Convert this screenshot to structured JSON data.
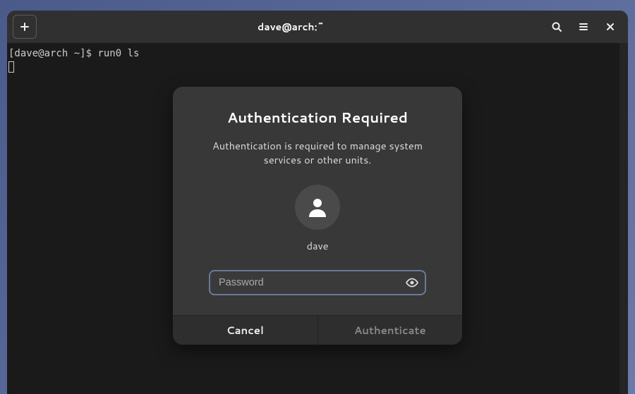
{
  "window": {
    "title": "dave@arch:~"
  },
  "terminal": {
    "prompt_line": "[dave@arch ~]$ run0 ls"
  },
  "dialog": {
    "title": "Authentication Required",
    "message": "Authentication is required to manage system services or other units.",
    "username": "dave",
    "password_placeholder": "Password",
    "cancel_label": "Cancel",
    "authenticate_label": "Authenticate"
  }
}
